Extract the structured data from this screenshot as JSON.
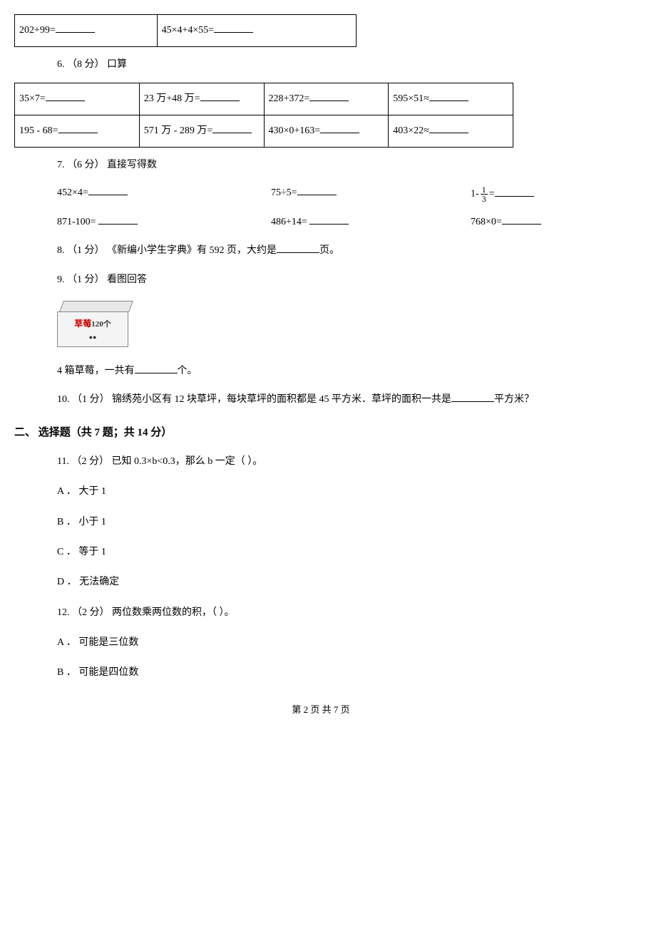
{
  "table1": {
    "r1c1": "202+99=",
    "r1c2": "45×4+4×55="
  },
  "q6": {
    "label": "6. （8 分） 口算"
  },
  "table2": {
    "r1c1": "35×7=",
    "r1c2": "23 万+48 万=",
    "r1c3": "228+372=",
    "r1c4": "595×51≈",
    "r2c1": "195 - 68=",
    "r2c2": "571 万 - 289 万=",
    "r2c3": "430×0+163=",
    "r2c4": "403×22≈"
  },
  "q7": {
    "label": "7. （6 分） 直接写得数",
    "row1": {
      "c1": "452×4=",
      "c2": "75÷5=",
      "c3a": "1-",
      "c3_num": "1",
      "c3_den": "3",
      "c3b": "="
    },
    "row2": {
      "c1": "871-100= ",
      "c2": "486+14= ",
      "c3": "768×0="
    }
  },
  "q8": {
    "text_a": "8. （1 分） 《新编小学生字典》有 592 页，大约是",
    "text_b": "页。"
  },
  "q9": {
    "label": "9. （1 分） 看图回答",
    "box_label1": "草莓",
    "box_label2": "120个",
    "text_a": "4 箱草莓，一共有",
    "text_b": "个。"
  },
  "q10": {
    "text_a": "10. （1 分） 锦绣苑小区有 12 块草坪，每块草坪的面积都是 45 平方米．草坪的面积一共是",
    "text_b": "平方米？"
  },
  "section2": "二、 选择题（共 7 题；共 14 分）",
  "q11": {
    "stem": "11. （2 分） 已知 0.3×b<0.3，那么 b 一定（    ）。",
    "A": "A ． 大于 1",
    "B": "B ． 小于 1",
    "C": "C ． 等于 1",
    "D": "D ． 无法确定"
  },
  "q12": {
    "stem": "12. （2 分） 两位数乘两位数的积，（    ）。",
    "A": "A ． 可能是三位数",
    "B": "B ． 可能是四位数"
  },
  "footer": "第 2 页 共 7 页"
}
